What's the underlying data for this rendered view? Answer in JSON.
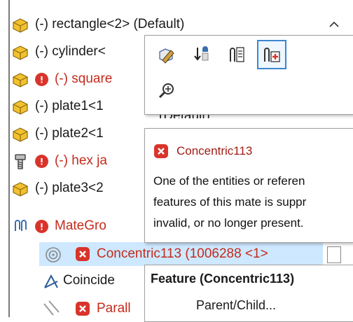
{
  "tree": {
    "items": [
      {
        "label": "(-) rectangle<2> (Default)",
        "icon": "part-icon",
        "error": false,
        "color": "#1a1a1a"
      },
      {
        "label": "(-) cylinder<",
        "icon": "part-icon",
        "error": false,
        "color": "#1a1a1a"
      },
      {
        "label": "(-) square",
        "icon": "part-icon",
        "error": true,
        "color": "#c42b1c"
      },
      {
        "label": "(-) plate1<1",
        "icon": "part-icon",
        "error": false,
        "color": "#1a1a1a"
      },
      {
        "label": "(-) plate2<1",
        "icon": "part-icon",
        "error": false,
        "color": "#1a1a1a"
      },
      {
        "label": "(-) hex ja",
        "icon": "bolt-icon",
        "error": true,
        "color": "#c42b1c"
      },
      {
        "label": "(-) plate3<2",
        "icon": "part-icon",
        "error": false,
        "color": "#1a1a1a"
      },
      {
        "label": "MateGro",
        "icon": "mates-icon",
        "error": true,
        "color": "#c42b1c"
      },
      {
        "label": "Concentric113 (1006288 <1>",
        "icon": "concentric-icon",
        "error": true,
        "color": "#c42b1c"
      },
      {
        "label": "Coincide",
        "icon": "coincident-icon",
        "error": false,
        "color": "#1a1a1a"
      },
      {
        "label": "Parall",
        "icon": "parallel-icon",
        "error": true,
        "color": "#c42b1c"
      }
    ],
    "partial_text": "(Default)"
  },
  "toolbar": {
    "buttons": [
      "edit-part-icon",
      "insert-mate-icon",
      "mate-properties-icon",
      "add-mate-icon",
      "zoom-icon"
    ]
  },
  "tooltip": {
    "title": "Concentric113",
    "line1": "One of the entities or referen",
    "line2": "features of this mate is suppr",
    "line3": "invalid, or no longer present."
  },
  "context_menu": {
    "header": "Feature (Concentric113)",
    "item1": "Parent/Child..."
  },
  "colors": {
    "error_red": "#d9342b",
    "selection": "#cde8ff",
    "highlight_border": "#3a86d0"
  }
}
